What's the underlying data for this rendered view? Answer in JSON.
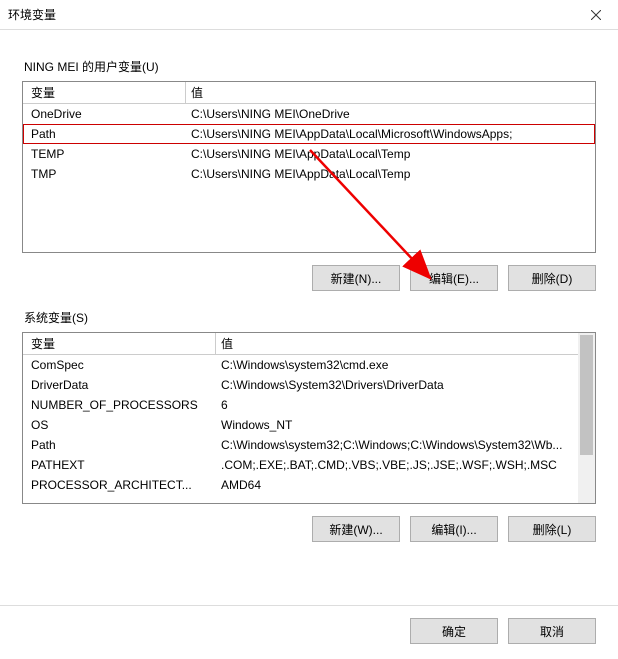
{
  "window": {
    "title": "环境变量"
  },
  "user_section": {
    "label": "NING MEI 的用户变量(U)",
    "header_var": "变量",
    "header_val": "值",
    "rows": [
      {
        "name": "OneDrive",
        "value": "C:\\Users\\NING MEI\\OneDrive"
      },
      {
        "name": "Path",
        "value": "C:\\Users\\NING MEI\\AppData\\Local\\Microsoft\\WindowsApps;"
      },
      {
        "name": "TEMP",
        "value": "C:\\Users\\NING MEI\\AppData\\Local\\Temp"
      },
      {
        "name": "TMP",
        "value": "C:\\Users\\NING MEI\\AppData\\Local\\Temp"
      }
    ],
    "buttons": {
      "new": "新建(N)...",
      "edit": "编辑(E)...",
      "delete": "删除(D)"
    }
  },
  "system_section": {
    "label": "系统变量(S)",
    "header_var": "变量",
    "header_val": "值",
    "rows": [
      {
        "name": "ComSpec",
        "value": "C:\\Windows\\system32\\cmd.exe"
      },
      {
        "name": "DriverData",
        "value": "C:\\Windows\\System32\\Drivers\\DriverData"
      },
      {
        "name": "NUMBER_OF_PROCESSORS",
        "value": "6"
      },
      {
        "name": "OS",
        "value": "Windows_NT"
      },
      {
        "name": "Path",
        "value": "C:\\Windows\\system32;C:\\Windows;C:\\Windows\\System32\\Wb..."
      },
      {
        "name": "PATHEXT",
        "value": ".COM;.EXE;.BAT;.CMD;.VBS;.VBE;.JS;.JSE;.WSF;.WSH;.MSC"
      },
      {
        "name": "PROCESSOR_ARCHITECT...",
        "value": "AMD64"
      }
    ],
    "buttons": {
      "new": "新建(W)...",
      "edit": "编辑(I)...",
      "delete": "删除(L)"
    }
  },
  "dialog_buttons": {
    "ok": "确定",
    "cancel": "取消"
  },
  "annotation": {
    "highlighted_row": "Path",
    "arrow_target": "edit"
  }
}
